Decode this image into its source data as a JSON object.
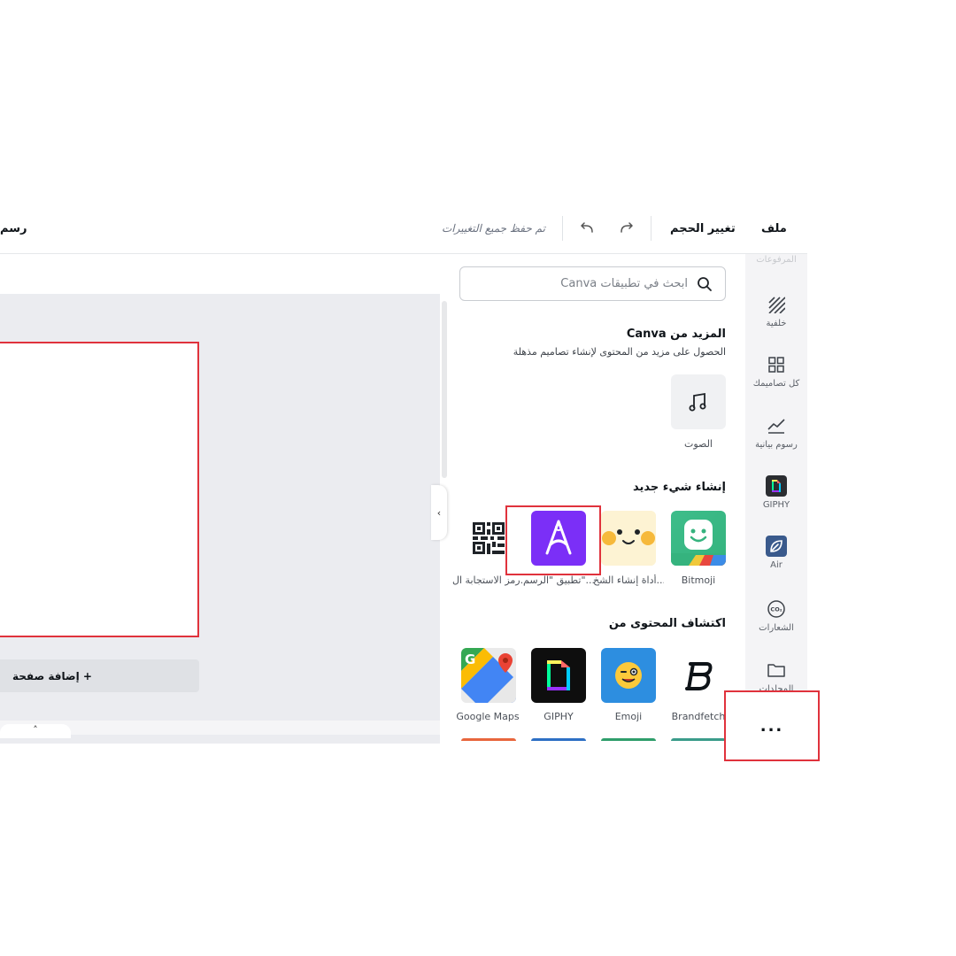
{
  "topbar": {
    "file_label": "ملف",
    "resize_label": "تغيير الحجم",
    "saved_status": "تم حفظ جميع التغييرات",
    "design_title": "رسم"
  },
  "canvas": {
    "add_page_label": "+ إضافة صفحة",
    "collapse_glyph": "˄"
  },
  "panel": {
    "search_placeholder": "ابحث في تطبيقات Canva",
    "more_from_canva": {
      "title": "المزيد من Canva",
      "subtitle": "الحصول على مزيد من المحتوى لإنشاء تصاميم مذهلة",
      "items": [
        {
          "label": "الصوت",
          "icon": "music-note-icon"
        }
      ]
    },
    "create_new": {
      "title": "إنشاء شيء جديد",
      "items": [
        {
          "label": "Bitmoji",
          "icon": "bitmoji-icon"
        },
        {
          "label": "أداة إنشاء الشخ...",
          "icon": "character-builder-icon"
        },
        {
          "label": "تطبيق \"الرسم\"...",
          "icon": "draw-app-icon"
        },
        {
          "label": "رمز الاستجابة ال...",
          "icon": "qr-code-icon"
        }
      ]
    },
    "discover": {
      "title": "اكتشاف المحتوى من",
      "items": [
        {
          "label": "Brandfetch",
          "icon": "brandfetch-icon"
        },
        {
          "label": "Emoji",
          "icon": "emoji-icon"
        },
        {
          "label": "GIPHY",
          "icon": "giphy-icon"
        },
        {
          "label": "Google Maps",
          "icon": "google-maps-icon"
        }
      ]
    },
    "handle_glyph": "‹"
  },
  "rail": {
    "items": [
      {
        "label": "المرفوعات",
        "icon": "upload-icon"
      },
      {
        "label": "خلفية",
        "icon": "background-pattern-icon"
      },
      {
        "label": "كل تصاميمك",
        "icon": "grid-icon"
      },
      {
        "label": "رسوم بيانية",
        "icon": "chart-icon"
      },
      {
        "label": "GIPHY",
        "icon": "giphy-icon"
      },
      {
        "label": "Air",
        "icon": "air-icon"
      },
      {
        "label": "الشعارات",
        "icon": "co2-logo-icon"
      },
      {
        "label": "المجلدات",
        "icon": "folder-icon"
      }
    ],
    "more_label": "..."
  },
  "colors": {
    "accent_red": "#e0323c",
    "draw_app_purple": "#7b2ff7",
    "canvas_bg": "#ebecf0"
  }
}
